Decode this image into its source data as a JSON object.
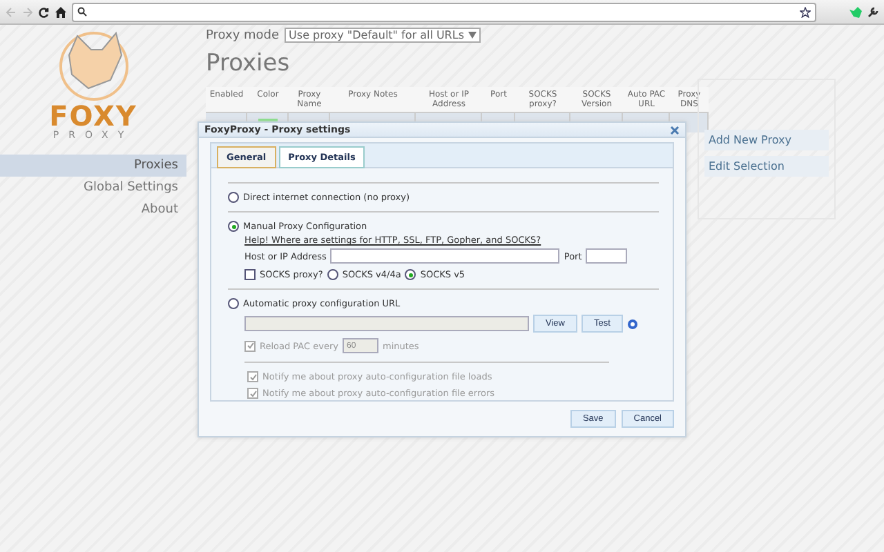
{
  "sidebar": {
    "logo_word": "FOXY",
    "logo_sub": "PROXY",
    "items": [
      {
        "label": "Proxies",
        "selected": true
      },
      {
        "label": "Global Settings",
        "selected": false
      },
      {
        "label": "About",
        "selected": false
      }
    ]
  },
  "proxy_mode": {
    "label": "Proxy mode",
    "value": "Use proxy \"Default\" for all URLs"
  },
  "title": "Proxies",
  "table": {
    "columns": [
      "Enabled",
      "Color",
      "Proxy Name",
      "Proxy Notes",
      "Host or IP Address",
      "Port",
      "SOCKS proxy?",
      "SOCKS Version",
      "Auto PAC URL",
      "Proxy DNS"
    ]
  },
  "actions": [
    {
      "label": "Add New Proxy"
    },
    {
      "label": "Edit Selection"
    }
  ],
  "dialog": {
    "title": "FoxyProxy - Proxy settings",
    "tabs": [
      {
        "label": "General",
        "selected": false
      },
      {
        "label": "Proxy Details",
        "selected": true
      }
    ],
    "modes": [
      {
        "kind": "direct",
        "label": "Direct internet connection (no proxy)",
        "selected": false
      },
      {
        "kind": "manual",
        "label": "Manual Proxy Configuration",
        "selected": true,
        "help_link": "Help! Where are settings for HTTP, SSL, FTP, Gopher, and SOCKS?",
        "host_label": "Host or IP Address",
        "port_label": "Port",
        "socks": {
          "label": "SOCKS proxy?",
          "checked": false
        },
        "socks_versions": [
          {
            "label": "SOCKS v4/4a",
            "selected": false
          },
          {
            "label": "SOCKS v5",
            "selected": true
          }
        ]
      },
      {
        "kind": "auto",
        "label": "Automatic proxy configuration URL",
        "selected": false,
        "buttons": [
          "View",
          "Test"
        ],
        "reload": {
          "label": "Reload PAC every",
          "checked": true,
          "disabled": true,
          "value": "60",
          "unit": "minutes"
        },
        "notifications": [
          {
            "label": "Notify me about proxy auto-configuration file loads",
            "checked": true,
            "disabled": true
          },
          {
            "label": "Notify me about proxy auto-configuration file errors",
            "checked": true,
            "disabled": true
          }
        ]
      }
    ],
    "buttons": [
      "Save",
      "Cancel"
    ]
  }
}
